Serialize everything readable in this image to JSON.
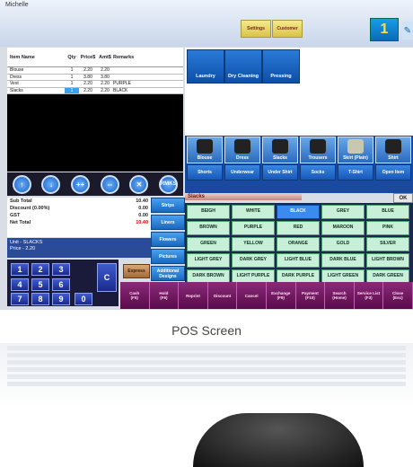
{
  "window": {
    "title": "Michelle"
  },
  "header": {
    "settings_label": "Settings",
    "customer_label": "Customer",
    "number": "1",
    "edge_icon": "edit-icon"
  },
  "order": {
    "columns": [
      "Item Name",
      "Qty",
      "Price$",
      "Amt$",
      "Remarks"
    ],
    "rows": [
      {
        "name": "Blouse",
        "qty": "1",
        "price": "2.20",
        "amt": "2.20",
        "remarks": ""
      },
      {
        "name": "Dress",
        "qty": "1",
        "price": "3.80",
        "amt": "3.80",
        "remarks": ""
      },
      {
        "name": "Vest",
        "qty": "1",
        "price": "2.20",
        "amt": "2.20",
        "remarks": "PURPLE"
      },
      {
        "name": "Slacks",
        "qty": "1",
        "price": "2.20",
        "amt": "2.20",
        "remarks": "BLACK"
      }
    ]
  },
  "action_buttons": [
    {
      "name": "up-icon",
      "label": "↑"
    },
    {
      "name": "down-icon",
      "label": "↓"
    },
    {
      "name": "increment-button",
      "label": "++"
    },
    {
      "name": "decrement-button",
      "label": "--"
    },
    {
      "name": "close-icon",
      "label": "✕"
    },
    {
      "name": "remarks-button",
      "label": "RMKS"
    }
  ],
  "totals": {
    "subtotal_label": "Sub Total",
    "subtotal": "10.40",
    "discount_label": "Discount (0.00%)",
    "discount": "0.00",
    "gst_label": "GST",
    "gst": "0.00",
    "net_label": "Net Total",
    "net": "10.40"
  },
  "last_item": {
    "line1": "Unit - SLACKS",
    "line2": "Price - 2.20"
  },
  "side_buttons": [
    "Strips",
    "Liners",
    "Flowers",
    "Pictures",
    "Additional Designs"
  ],
  "keypad": {
    "keys": [
      "1",
      "2",
      "3",
      "4",
      "5",
      "6",
      "7",
      "8",
      "9",
      "0"
    ],
    "clear": "C",
    "express": "Express"
  },
  "categories": [
    "Laundry",
    "Dry Cleaning",
    "Pressing"
  ],
  "items": [
    {
      "label": "Blouse",
      "icon": "blouse-icon"
    },
    {
      "label": "Dress",
      "icon": "dress-icon"
    },
    {
      "label": "Slacks",
      "icon": "slacks-icon"
    },
    {
      "label": "Trousers",
      "icon": "trousers-icon"
    },
    {
      "label": "Skirt (Plain)",
      "icon": "skirt-icon"
    },
    {
      "label": "Shirt",
      "icon": "shirt-icon"
    }
  ],
  "items_row2": [
    "Shorts",
    "Underwear",
    "Under Shirt",
    "Socks",
    "T-Shirt",
    "Open Item"
  ],
  "current_item": "Slacks",
  "ok_label": "OK",
  "colors": [
    "BEIGH",
    "WHITE",
    "BLACK",
    "GREY",
    "BLUE",
    "BROWN",
    "PURPLE",
    "RED",
    "MAROON",
    "PINK",
    "GREEN",
    "YELLOW",
    "ORANGE",
    "GOLD",
    "SILVER",
    "LIGHT GREY",
    "DARK GREY",
    "LIGHT BLUE",
    "DARK BLUE",
    "LIGHT BROWN",
    "DARK BROWN",
    "LIGHT PURPLE",
    "DARK PURPLE",
    "LIGHT GREEN",
    "DARK GREEN"
  ],
  "selected_color": "BLACK",
  "function_keys": [
    {
      "label": "Cash",
      "key": "(F5)"
    },
    {
      "label": "Hold",
      "key": "(F6)"
    },
    {
      "label": "Reprint",
      "key": ""
    },
    {
      "label": "Discount",
      "key": ""
    },
    {
      "label": "Cancel",
      "key": ""
    },
    {
      "label": "Exchange",
      "key": "(F9)"
    },
    {
      "label": "Payment",
      "key": "(F10)"
    },
    {
      "label": "Search",
      "key": "(Home)"
    },
    {
      "label": "Service List",
      "key": "(F3)"
    },
    {
      "label": "Close",
      "key": "(Esc)"
    }
  ],
  "caption": "POS Screen"
}
